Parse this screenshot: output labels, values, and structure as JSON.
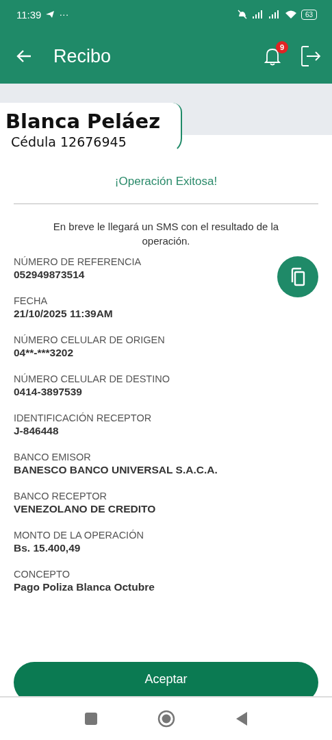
{
  "status_bar": {
    "time": "11:39",
    "more": "···",
    "battery": "63"
  },
  "header": {
    "title": "Recibo",
    "notification_count": "9"
  },
  "overlay": {
    "name": "Blanca Peláez",
    "id_line": "Cédula 12676945"
  },
  "receipt": {
    "status": "¡Operación Exitosa!",
    "message": "En breve le llegará un SMS con el resultado de la operación.",
    "fields": [
      {
        "label": "NÚMERO DE REFERENCIA",
        "value": "052949873514"
      },
      {
        "label": "FECHA",
        "value": "21/10/2025 11:39AM"
      },
      {
        "label": "NÚMERO CELULAR DE ORIGEN",
        "value": "04**-***3202"
      },
      {
        "label": "NÚMERO CELULAR DE DESTINO",
        "value": "0414-3897539"
      },
      {
        "label": "IDENTIFICACIÓN RECEPTOR",
        "value": "J-846448"
      },
      {
        "label": "BANCO EMISOR",
        "value": "BANESCO BANCO UNIVERSAL S.A.C.A."
      },
      {
        "label": "BANCO RECEPTOR",
        "value": "VENEZOLANO DE CREDITO"
      },
      {
        "label": "MONTO DE LA OPERACIÓN",
        "value": "Bs. 15.400,49"
      },
      {
        "label": "CONCEPTO",
        "value": "Pago Poliza Blanca Octubre"
      }
    ]
  },
  "accept_button": "Aceptar"
}
